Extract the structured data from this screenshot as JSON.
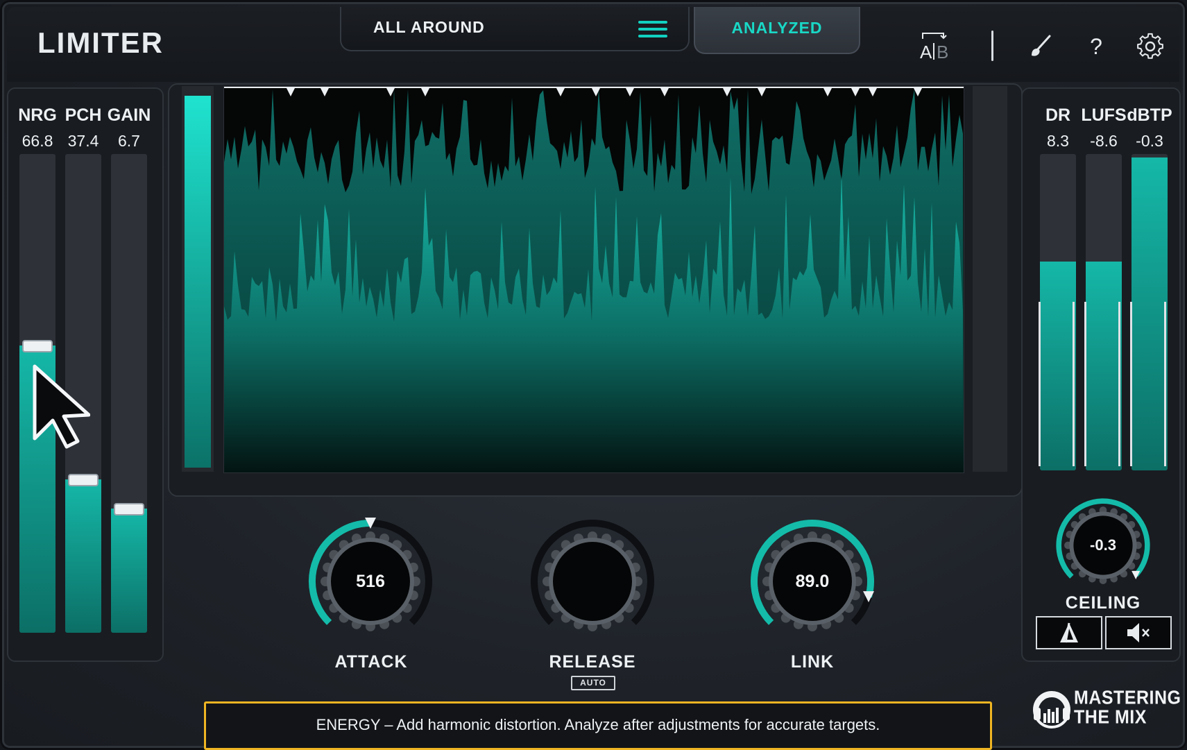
{
  "app": {
    "title": "LIMITER"
  },
  "header": {
    "preset_name": "ALL AROUND",
    "analyzed_label": "ANALYZED",
    "ab_label_a": "A",
    "ab_label_b": "B",
    "help_label": "?"
  },
  "left_meters": [
    {
      "label": "NRG",
      "value": "66.8",
      "fill": 0.6
    },
    {
      "label": "PCH",
      "value": "37.4",
      "fill": 0.32
    },
    {
      "label": "GAIN",
      "value": "6.7",
      "fill": 0.26
    }
  ],
  "right_meters": [
    {
      "label": "DR",
      "value": "8.3",
      "fill": 0.66
    },
    {
      "label": "LUFS",
      "value": "-8.6",
      "fill": 0.66
    },
    {
      "label": "dBTP",
      "value": "-0.3",
      "fill": 0.99
    }
  ],
  "knobs": {
    "attack": {
      "label": "ATTACK",
      "value": "516",
      "level": 0.5
    },
    "release": {
      "label": "RELEASE",
      "value": "",
      "auto_label": "AUTO",
      "level": 0
    },
    "link": {
      "label": "LINK",
      "value": "89.0",
      "level": 0.89
    },
    "ceiling": {
      "label": "CEILING",
      "value": "-0.3",
      "level": 0.99
    }
  },
  "status_message": "ENERGY – Add harmonic distortion. Analyze after adjustments for accurate targets.",
  "logo": {
    "line1": "MASTERING",
    "line2": "THE MIX"
  },
  "colors": {
    "accent": "#12d1c0",
    "highlight": "#f0b522",
    "background": "#1f2329"
  },
  "icons": [
    "menu-icon",
    "ab-compare-icon",
    "brush-icon",
    "help-icon",
    "gear-icon",
    "delta-icon",
    "mute-icon",
    "cursor-arrow-icon",
    "headphones-logo-icon"
  ]
}
